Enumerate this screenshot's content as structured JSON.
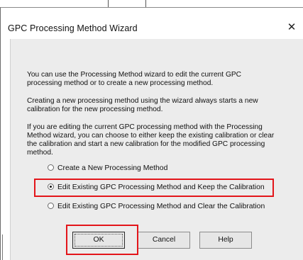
{
  "window": {
    "title": "GPC Processing Method Wizard",
    "close_glyph": "✕"
  },
  "paragraphs": [
    "You can use the Processing Method wizard to edit the current GPC processing method or to create a new processing method.",
    "Creating a new processing method using the wizard always starts a new calibration for the new processing method.",
    "If you are editing the current GPC processing method with the Processing Method wizard, you can choose to either keep the existing calibration or clear the calibration and start a new calibration for the modified GPC processing method."
  ],
  "options": [
    {
      "label": "Create a New Processing Method",
      "checked": false
    },
    {
      "label": "Edit Existing GPC Processing Method and Keep the Calibration",
      "checked": true
    },
    {
      "label": "Edit Existing GPC Processing Method and Clear the Calibration",
      "checked": false
    }
  ],
  "buttons": {
    "ok": "OK",
    "cancel": "Cancel",
    "help": "Help"
  },
  "colors": {
    "highlight": "#e3151a",
    "dialog_face": "#ececec"
  }
}
